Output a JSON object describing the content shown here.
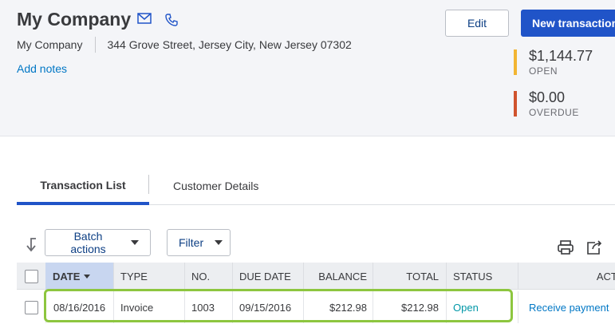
{
  "customer": {
    "title": "My Company",
    "company": "My Company",
    "address": "344 Grove Street, Jersey City, New Jersey 07302",
    "add_notes": "Add notes"
  },
  "actions": {
    "edit": "Edit",
    "new_transaction": "New transaction"
  },
  "summary": {
    "open_amount": "$1,144.77",
    "open_label": "OPEN",
    "open_color": "#f2b533",
    "overdue_amount": "$0.00",
    "overdue_label": "OVERDUE",
    "overdue_color": "#d0532e"
  },
  "tabs": [
    {
      "label": "Transaction List",
      "active": true
    },
    {
      "label": "Customer Details",
      "active": false
    }
  ],
  "toolbar": {
    "batch_actions": "Batch actions",
    "filter": "Filter",
    "icons": [
      "sort-arrow-icon",
      "print-icon",
      "export-icon",
      "settings-icon"
    ]
  },
  "table": {
    "columns": [
      "DATE",
      "TYPE",
      "NO.",
      "DUE DATE",
      "BALANCE",
      "TOTAL",
      "STATUS",
      "ACTION"
    ],
    "sorted_column": "DATE",
    "rows": [
      {
        "date": "08/16/2016",
        "type": "Invoice",
        "no": "1003",
        "due_date": "09/15/2016",
        "balance": "$212.98",
        "total": "$212.98",
        "status": "Open",
        "action": "Receive payment"
      }
    ]
  },
  "colors": {
    "accent": "#2054c8",
    "highlight": "#8dc63f",
    "link": "#0077c5",
    "status_open": "#0097a7"
  }
}
